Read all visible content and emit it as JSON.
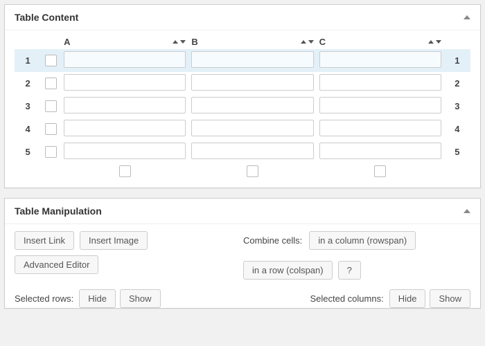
{
  "content": {
    "title": "Table Content",
    "columns": [
      "A",
      "B",
      "C"
    ],
    "rows": [
      {
        "n": "1",
        "selected": true,
        "values": [
          "",
          "",
          ""
        ]
      },
      {
        "n": "2",
        "selected": false,
        "values": [
          "",
          "",
          ""
        ]
      },
      {
        "n": "3",
        "selected": false,
        "values": [
          "",
          "",
          ""
        ]
      },
      {
        "n": "4",
        "selected": false,
        "values": [
          "",
          "",
          ""
        ]
      },
      {
        "n": "5",
        "selected": false,
        "values": [
          "",
          "",
          ""
        ]
      }
    ]
  },
  "manipulation": {
    "title": "Table Manipulation",
    "buttons": {
      "insert_link": "Insert Link",
      "insert_image": "Insert Image",
      "advanced_editor": "Advanced Editor",
      "rowspan": "in a column (rowspan)",
      "colspan": "in a row (colspan)",
      "help": "?",
      "hide": "Hide",
      "show": "Show"
    },
    "labels": {
      "combine_cells": "Combine cells:",
      "selected_rows": "Selected rows:",
      "selected_columns": "Selected columns:"
    }
  }
}
